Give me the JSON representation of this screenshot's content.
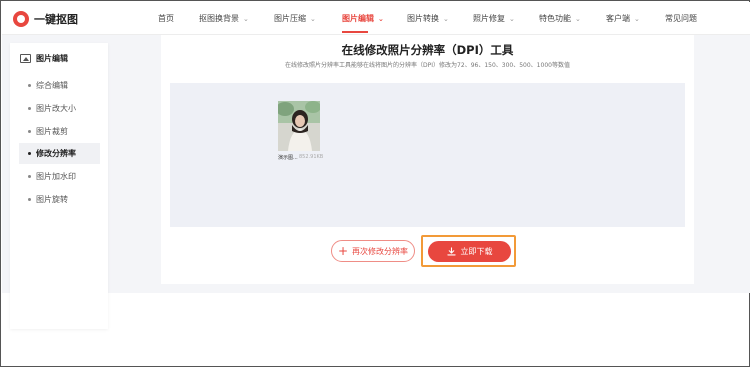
{
  "brand": {
    "name": "一键抠图",
    "accent": "#e8473f",
    "highlight": "#f29a38"
  },
  "nav": {
    "items": [
      {
        "label": "首页",
        "has_dropdown": false
      },
      {
        "label": "抠图换背景",
        "has_dropdown": true
      },
      {
        "label": "图片压缩",
        "has_dropdown": true
      },
      {
        "label": "图片编辑",
        "has_dropdown": true,
        "active": true
      },
      {
        "label": "图片转换",
        "has_dropdown": true
      },
      {
        "label": "照片修复",
        "has_dropdown": true
      },
      {
        "label": "特色功能",
        "has_dropdown": true
      },
      {
        "label": "客户端",
        "has_dropdown": true
      },
      {
        "label": "常见问题",
        "has_dropdown": false
      }
    ]
  },
  "sidebar": {
    "heading": "图片编辑",
    "items": [
      {
        "label": "综合编辑"
      },
      {
        "label": "图片改大小"
      },
      {
        "label": "图片裁剪"
      },
      {
        "label": "修改分辨率",
        "active": true
      },
      {
        "label": "图片加水印"
      },
      {
        "label": "图片旋转"
      }
    ]
  },
  "main": {
    "title": "在线修改照片分辨率（DPI）工具",
    "subtitle": "在线修改照片分辨率工具能够在线将图片的分辨率（DPI）修改为72、96、150、300、500、1000等数值",
    "file": {
      "name": "演示图...",
      "size": "852.91KB"
    },
    "redo_button": "再次修改分辨率",
    "download_button": "立即下载"
  }
}
